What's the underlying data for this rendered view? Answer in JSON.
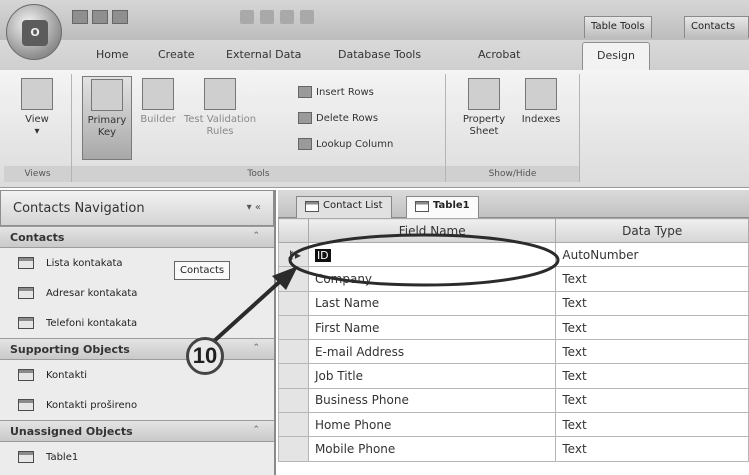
{
  "titlebar": {
    "office_logo": "O",
    "context_tabs": [
      "Table Tools",
      "Contacts"
    ]
  },
  "ribbon": {
    "tabs": [
      "Home",
      "Create",
      "External Data",
      "Database Tools",
      "Acrobat",
      "Design"
    ],
    "active_tab": "Design",
    "views_group": {
      "label": "Views",
      "view_label": "View"
    },
    "tools_group": {
      "label": "Tools",
      "primary_key_label": "Primary Key",
      "builder_label": "Builder",
      "test_validation_label": "Test Validation Rules",
      "insert_rows_label": "Insert Rows",
      "delete_rows_label": "Delete Rows",
      "lookup_column_label": "Lookup Column"
    },
    "showhide_group": {
      "label": "Show/Hide",
      "property_sheet_label": "Property Sheet",
      "indexes_label": "Indexes"
    }
  },
  "navigation": {
    "title": "Contacts Navigation",
    "controls": "▾ «",
    "sections": [
      {
        "title": "Contacts",
        "items": [
          "Lista kontakata",
          "Adresar kontakata",
          "Telefoni kontakata"
        ]
      },
      {
        "title": "Supporting Objects",
        "items": [
          "Kontakti",
          "Kontakti prošireno"
        ]
      },
      {
        "title": "Unassigned Objects",
        "items": [
          "Table1"
        ]
      }
    ],
    "tooltip": "Contacts"
  },
  "document": {
    "tabs": [
      "Contact List",
      "Table1"
    ],
    "active_tab": "Table1",
    "columns": [
      "Field Name",
      "Data Type"
    ],
    "rows": [
      {
        "field": "ID",
        "type": "AutoNumber",
        "primary_key": true
      },
      {
        "field": "Company",
        "type": "Text"
      },
      {
        "field": "Last Name",
        "type": "Text"
      },
      {
        "field": "First Name",
        "type": "Text"
      },
      {
        "field": "E-mail Address",
        "type": "Text"
      },
      {
        "field": "Job Title",
        "type": "Text"
      },
      {
        "field": "Business Phone",
        "type": "Text"
      },
      {
        "field": "Home Phone",
        "type": "Text"
      },
      {
        "field": "Mobile Phone",
        "type": "Text"
      }
    ],
    "primary_key_marker": "⚷▸"
  },
  "annotation": {
    "callout_number": "10"
  }
}
